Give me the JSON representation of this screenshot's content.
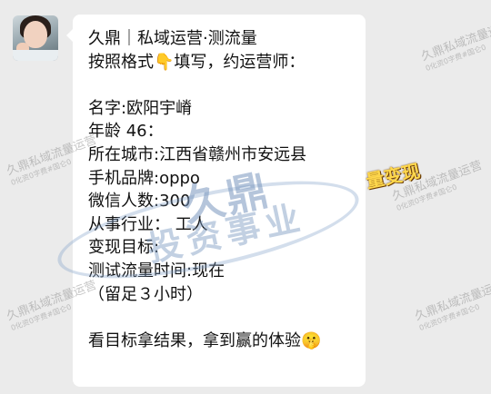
{
  "chat": {
    "lines": [
      "久鼎｜私域运营·测流量",
      "按照格式👇填写，约运营师：",
      "",
      "名字:欧阳宇嵴",
      "年龄 46：",
      "所在城市:江西省赣州市安远县",
      "手机品牌:oppo",
      "微信人数:300",
      "从事行业： 工人",
      "变现目标:",
      "测试流量时间:现在",
      "（留足３小时）",
      "",
      "看目标拿结果，拿到赢的体验🤫"
    ]
  },
  "watermarks": {
    "brand_main": "久鼎",
    "brand_sub": "投资事业",
    "tile_text": "久鼎私域流量运营",
    "tile_sub": "0化资0字费#国仑0",
    "sticker": "量变现"
  }
}
